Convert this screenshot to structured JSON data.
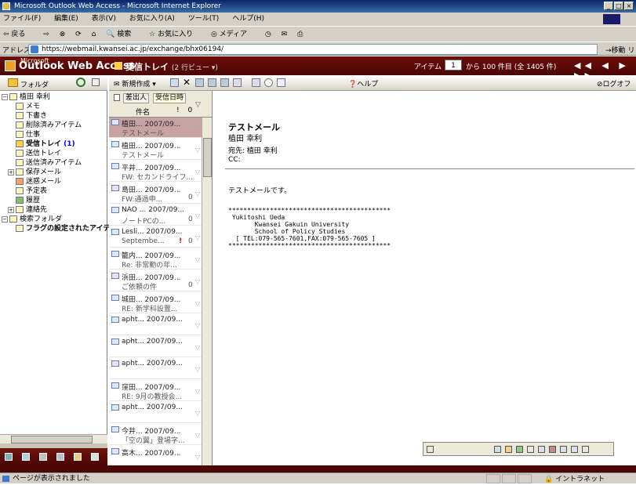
{
  "window": {
    "title": "Microsoft Outlook Web Access - Microsoft Internet Explorer"
  },
  "menu": [
    "ファイル(F)",
    "編集(E)",
    "表示(V)",
    "お気に入り(A)",
    "ツール(T)",
    "ヘルプ(H)"
  ],
  "toolbar": [
    "戻る",
    "検索",
    "お気に入り",
    "メディア"
  ],
  "address": {
    "label": "アドレス(D)",
    "url": "https://webmail.kwansei.ac.jp/exchange/bhx06194/",
    "go": "移動",
    "links": "リンク"
  },
  "owa": {
    "brand": "Outlook Web Access",
    "brand_small": "Microsoft",
    "folder": "受信トレイ",
    "view": "(2 行ビュー ▾)",
    "items_label": "アイテム",
    "page": "1",
    "range": "から 100 件目 (全 1405 件)",
    "nav": "◀◀ ◀ ▶ ▶▶"
  },
  "left": {
    "header": "フォルダ",
    "tree": [
      {
        "label": "植田  幸利",
        "level": 0
      },
      {
        "label": "メモ",
        "level": 2
      },
      {
        "label": "下書き",
        "level": 2
      },
      {
        "label": "削除済みアイテム",
        "level": 2
      },
      {
        "label": "仕事",
        "level": 2
      },
      {
        "label": "受信トレイ",
        "count": "(1)",
        "level": 2,
        "bold": true
      },
      {
        "label": "送信トレイ",
        "level": 2
      },
      {
        "label": "送信済みアイテム",
        "level": 2
      },
      {
        "label": "保存メール",
        "level": 1
      },
      {
        "label": "迷惑メール",
        "level": 2
      },
      {
        "label": "予定表",
        "level": 2
      },
      {
        "label": "履歴",
        "level": 2
      },
      {
        "label": "連絡先",
        "level": 1
      },
      {
        "label": "検索フォルダ",
        "level": 0
      },
      {
        "label": "フラグの設定されたアイテム",
        "level": 2,
        "bold": true
      }
    ]
  },
  "midtool": {
    "new": "新規作成 ▾",
    "help": "ヘルプ",
    "logoff": "ログオフ"
  },
  "list": {
    "col_from": "差出人",
    "col_date": "受信日時",
    "col_subject": "件名",
    "col_flags": "! 0",
    "rows": [
      {
        "from": "植田... 2007/09...",
        "subject": "テストメール",
        "selected": true
      },
      {
        "from": "植田... 2007/09...",
        "subject": "テストメール"
      },
      {
        "from": "平井... 2007/09...",
        "subject": "FW: セカンドライフ..."
      },
      {
        "from": "島田... 2007/09...",
        "subject": "FW:通過申...",
        "att": "0"
      },
      {
        "from": "NAO ... 2007/09...",
        "subject": "ノートPCの...",
        "att": "0"
      },
      {
        "from": "Lesli... 2007/09...",
        "subject": "Septembe...",
        "imp": "!",
        "att": "0"
      },
      {
        "from": "籠内... 2007/09...",
        "subject": "Re: 非常勤の年..."
      },
      {
        "from": "浜田... 2007/09...",
        "subject": "ご依頼の件",
        "att": "0"
      },
      {
        "from": "城田... 2007/09...",
        "subject": "RE: 新学科設置..."
      },
      {
        "from": "apht... 2007/09...",
        "subject": ""
      },
      {
        "from": "apht... 2007/09...",
        "subject": ""
      },
      {
        "from": "apht... 2007/09...",
        "subject": ""
      },
      {
        "from": "窪田... 2007/09...",
        "subject": "RE: 9月の教授会..."
      },
      {
        "from": "apht... 2007/09...",
        "subject": ""
      },
      {
        "from": "今井... 2007/09...",
        "subject": "「空の翼」登場字..."
      },
      {
        "from": "高木... 2007/09...",
        "subject": ""
      }
    ]
  },
  "preview": {
    "title": "テストメール",
    "sender": "植田  幸利",
    "to": "宛先:  植田  幸利",
    "cc": "CC:",
    "body": "テストメールです。",
    "signature": "*******************************************\n Yukitoshi Ueda\n       Kwansei Gakuin University\n       School of Policy Studies\n  [ TEL:079-565-7601,FAX:079-565-7605 ]\n*******************************************"
  },
  "status": {
    "text": "ページが表示されました",
    "zone": "イントラネット"
  },
  "colors": {
    "owa_header": "#6e0e08",
    "selected_row": "#c7a3a3",
    "titlebar": "#0a246a"
  }
}
